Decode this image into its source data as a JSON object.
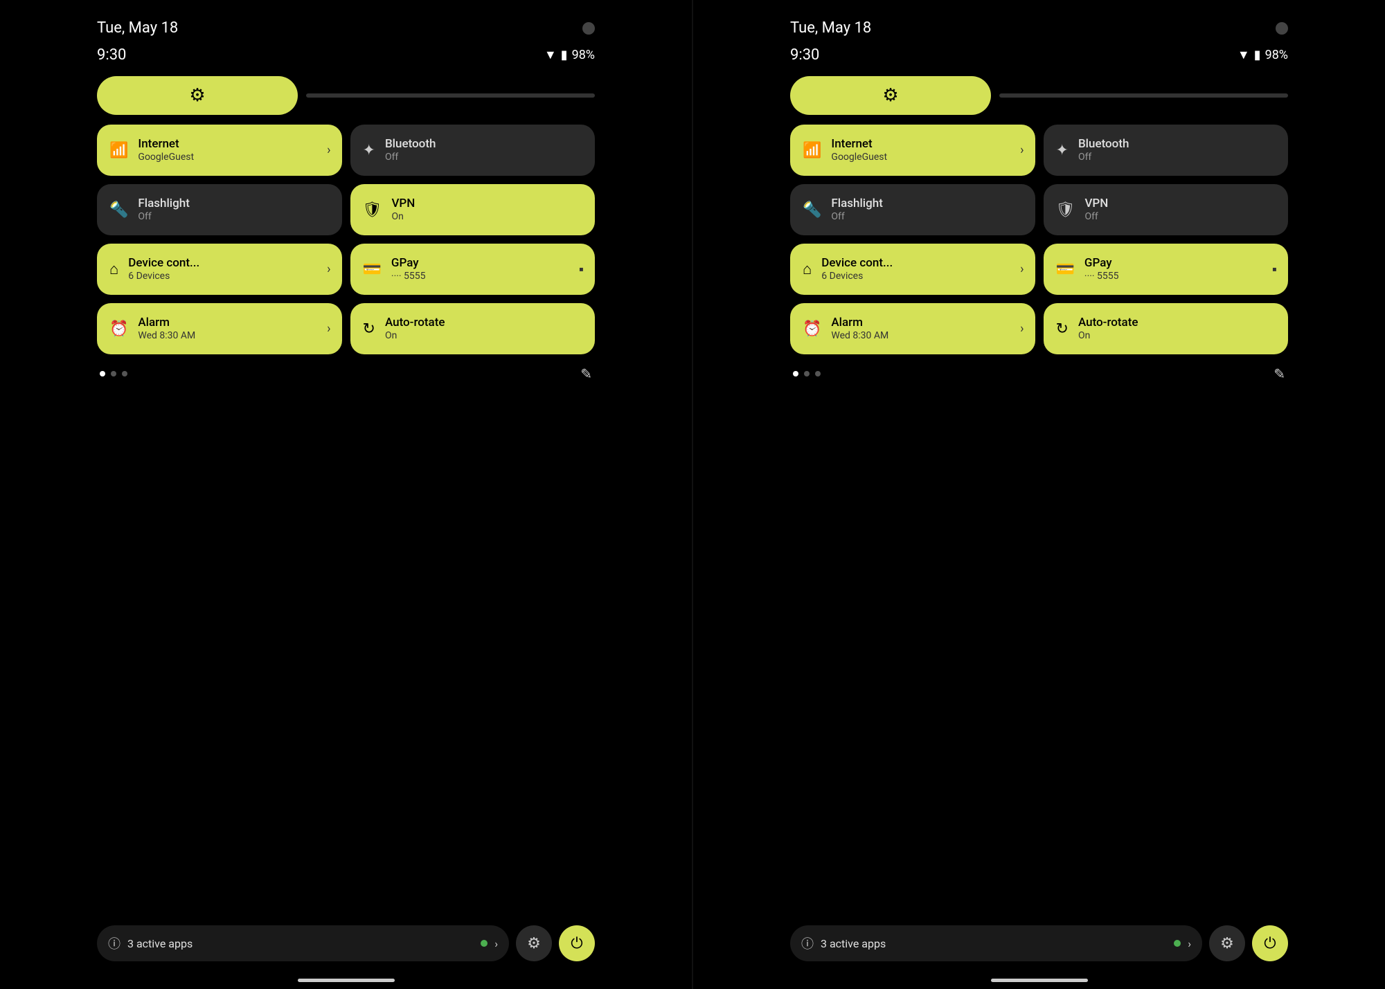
{
  "panels": [
    {
      "id": "left",
      "status_bar": {
        "date": "Tue, May 18",
        "time": "9:30",
        "battery_pct": "98%"
      },
      "brightness": {
        "icon": "⚙"
      },
      "tiles": [
        {
          "id": "internet",
          "label": "Internet",
          "sub": "GoogleGuest",
          "icon": "◆",
          "active": true,
          "has_chevron": true,
          "has_card": false
        },
        {
          "id": "bluetooth",
          "label": "Bluetooth",
          "sub": "Off",
          "icon": "✦",
          "active": false,
          "has_chevron": false,
          "has_card": false
        },
        {
          "id": "flashlight",
          "label": "Flashlight",
          "sub": "Off",
          "icon": "🔦",
          "active": false,
          "has_chevron": false,
          "has_card": false
        },
        {
          "id": "vpn",
          "label": "VPN",
          "sub": "On",
          "icon": "🛡",
          "active": true,
          "has_chevron": false,
          "has_card": false
        },
        {
          "id": "device-control",
          "label": "Device cont...",
          "sub": "6 Devices",
          "icon": "⌂",
          "active": true,
          "has_chevron": true,
          "has_card": false
        },
        {
          "id": "gpay",
          "label": "GPay",
          "sub": "···· 5555",
          "icon": "💳",
          "active": true,
          "has_chevron": false,
          "has_card": true
        },
        {
          "id": "alarm",
          "label": "Alarm",
          "sub": "Wed 8:30 AM",
          "icon": "⏰",
          "active": true,
          "has_chevron": true,
          "has_card": false
        },
        {
          "id": "auto-rotate",
          "label": "Auto-rotate",
          "sub": "On",
          "icon": "↻",
          "active": true,
          "has_chevron": false,
          "has_card": false
        }
      ],
      "pagination": {
        "dots": [
          true,
          false,
          false
        ]
      },
      "bottom": {
        "active_apps_count": "3",
        "active_apps_label": "active apps"
      }
    },
    {
      "id": "right",
      "status_bar": {
        "date": "Tue, May 18",
        "time": "9:30",
        "battery_pct": "98%"
      },
      "brightness": {
        "icon": "⚙"
      },
      "tiles": [
        {
          "id": "internet",
          "label": "Internet",
          "sub": "GoogleGuest",
          "icon": "◆",
          "active": true,
          "has_chevron": true,
          "has_card": false
        },
        {
          "id": "bluetooth",
          "label": "Bluetooth",
          "sub": "Off",
          "icon": "✦",
          "active": false,
          "has_chevron": false,
          "has_card": false
        },
        {
          "id": "flashlight",
          "label": "Flashlight",
          "sub": "Off",
          "icon": "🔦",
          "active": false,
          "has_chevron": false,
          "has_card": false
        },
        {
          "id": "vpn",
          "label": "VPN",
          "sub": "Off",
          "icon": "🛡",
          "active": false,
          "has_chevron": false,
          "has_card": false
        },
        {
          "id": "device-control",
          "label": "Device cont...",
          "sub": "6 Devices",
          "icon": "⌂",
          "active": true,
          "has_chevron": true,
          "has_card": false
        },
        {
          "id": "gpay",
          "label": "GPay",
          "sub": "···· 5555",
          "icon": "💳",
          "active": true,
          "has_chevron": false,
          "has_card": true
        },
        {
          "id": "alarm",
          "label": "Alarm",
          "sub": "Wed 8:30 AM",
          "icon": "⏰",
          "active": true,
          "has_chevron": true,
          "has_card": false
        },
        {
          "id": "auto-rotate",
          "label": "Auto-rotate",
          "sub": "On",
          "icon": "↻",
          "active": true,
          "has_chevron": false,
          "has_card": false
        }
      ],
      "pagination": {
        "dots": [
          true,
          false,
          false
        ]
      },
      "bottom": {
        "active_apps_count": "3",
        "active_apps_label": "active apps"
      }
    }
  ]
}
